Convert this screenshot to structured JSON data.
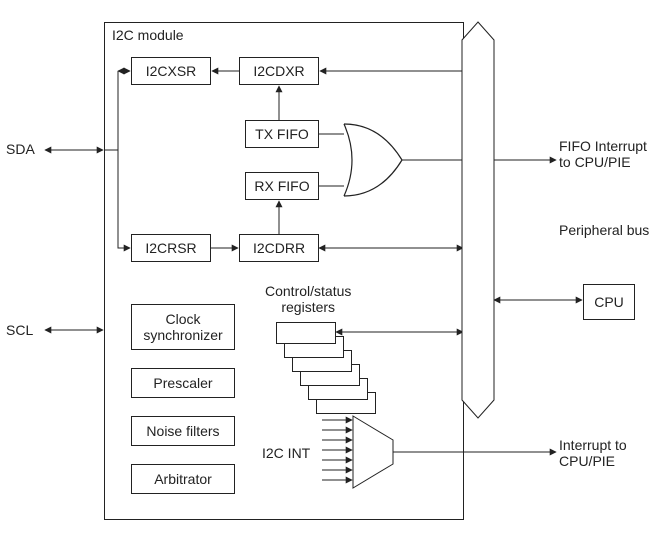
{
  "module_title": "I2C module",
  "pins": {
    "sda": "SDA",
    "scl": "SCL"
  },
  "boxes": {
    "i2cxsr": "I2CXSR",
    "i2cdxr": "I2CDXR",
    "txfifo": "TX FIFO",
    "rxfifo": "RX FIFO",
    "i2crsr": "I2CRSR",
    "i2cdrr": "I2CDRR",
    "clock_sync": "Clock\nsynchronizer",
    "prescaler": "Prescaler",
    "noise": "Noise filters",
    "arbitrator": "Arbitrator",
    "cpu": "CPU"
  },
  "labels": {
    "ctrl_status": "Control/status\nregisters",
    "i2c_int": "I2C INT",
    "peripheral_bus": "Peripheral bus",
    "fifo_int": "FIFO Interrupt\nto CPU/PIE",
    "interrupt": "Interrupt to\nCPU/PIE"
  }
}
